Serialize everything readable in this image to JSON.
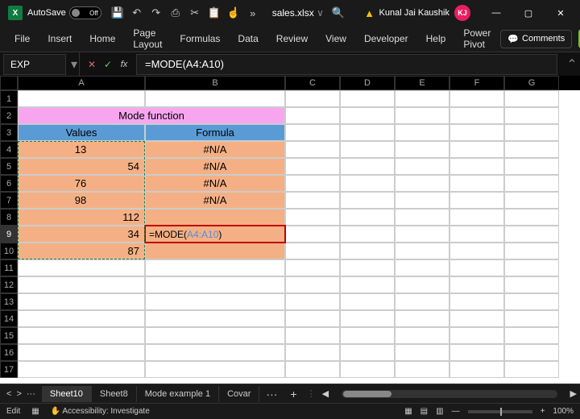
{
  "titlebar": {
    "autosave_label": "AutoSave",
    "autosave_state": "Off",
    "filename": "sales.xlsx",
    "filename_dd": "∨",
    "user_name": "Kunal Jai Kaushik",
    "user_initials": "KJ"
  },
  "ribbon": {
    "tabs": [
      "File",
      "Insert",
      "Home",
      "Page Layout",
      "Formulas",
      "Data",
      "Review",
      "View",
      "Developer",
      "Help",
      "Power Pivot"
    ],
    "comments": "Comments"
  },
  "formulabar": {
    "namebox": "EXP",
    "formula": "=MODE(A4:A10)"
  },
  "grid": {
    "columns": [
      "A",
      "B",
      "C",
      "D",
      "E",
      "F",
      "G"
    ],
    "rows_shown": 17,
    "title": "Mode function",
    "headers": {
      "a": "Values",
      "b": "Formula"
    },
    "values_a": [
      "13",
      "54",
      "76",
      "98",
      "112",
      "34",
      "87"
    ],
    "values_b": [
      "#N/A",
      "#N/A",
      "#N/A",
      "#N/A",
      "",
      "",
      ""
    ],
    "editing_row": 9,
    "editing_text_fn": "=MODE(",
    "editing_text_ref": "A4:A10",
    "editing_text_close": ")"
  },
  "sheets": {
    "tabs": [
      "Sheet10",
      "Sheet8",
      "Mode example 1",
      "Covar"
    ],
    "nav_left": "<",
    "nav_right": ">",
    "more": "···",
    "add": "+"
  },
  "status": {
    "mode": "Edit",
    "accessibility": "Accessibility: Investigate",
    "zoom": "100%"
  }
}
